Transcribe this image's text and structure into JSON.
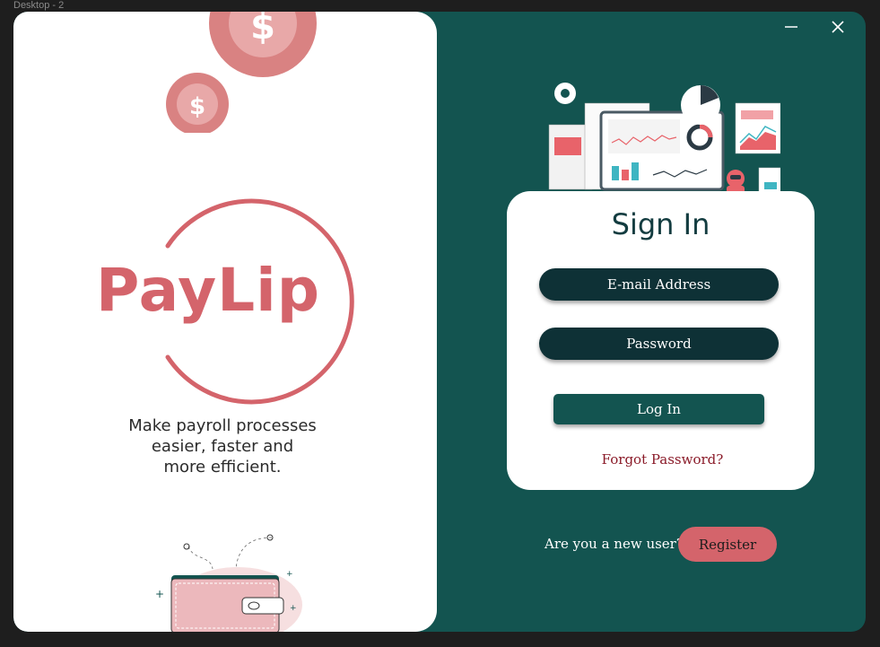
{
  "frame": {
    "label": "Desktop - 2"
  },
  "window": {
    "minimize_icon": "minimize-icon",
    "close_icon": "close-icon"
  },
  "brand": {
    "name": "PayLip",
    "tagline": "Make payroll processes easier, faster and more efficient."
  },
  "signin": {
    "title": "Sign In",
    "email_placeholder": "E-mail Address",
    "password_placeholder": "Password",
    "login_label": "Log In",
    "forgot_label": "Forgot Password?"
  },
  "register": {
    "prompt": "Are you a new user?",
    "button_label": "Register"
  },
  "coin_symbol": "$",
  "colors": {
    "teal_bg": "#135450",
    "dark_field": "#0e3136",
    "brand_pink": "#d4646b",
    "forgot_red": "#8a1a28"
  }
}
